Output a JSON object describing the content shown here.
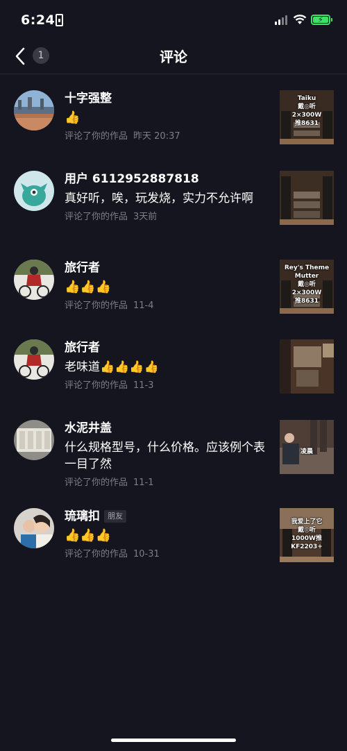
{
  "status_bar": {
    "time": "6:24"
  },
  "nav": {
    "back_badge": "1",
    "title": "评论"
  },
  "comments": [
    {
      "name": "十字强整",
      "text": "👍",
      "meta": "评论了你的作品",
      "date": "昨天 20:37",
      "thumb_text": "Taiku\n戴◎听\n2×300W\n推8631"
    },
    {
      "name": "用户 6112952887818",
      "text": "真好听，唉，玩发烧，实力不允许啊",
      "meta": "评论了你的作品",
      "date": "3天前",
      "thumb_text": ""
    },
    {
      "name": "旅行者",
      "text": "👍👍👍",
      "meta": "评论了你的作品",
      "date": "11-4",
      "thumb_text": "Rey's Theme\nMutter\n戴◎听\n2×300W\n推8631"
    },
    {
      "name": "旅行者",
      "text": "老味道👍👍👍👍",
      "meta": "评论了你的作品",
      "date": "11-3",
      "thumb_text": ""
    },
    {
      "name": "水泥井盖",
      "text": "什么规格型号，什么价格。应该例个表一目了然",
      "meta": "评论了你的作品",
      "date": "11-1",
      "thumb_text": "凌晨"
    },
    {
      "name": "琉璃扣",
      "friend_badge": "朋友",
      "text": "👍👍👍",
      "meta": "评论了你的作品",
      "date": "10-31",
      "thumb_text": "我爱上了它\n戴◎听\n1000W推\nKF2203+"
    }
  ]
}
